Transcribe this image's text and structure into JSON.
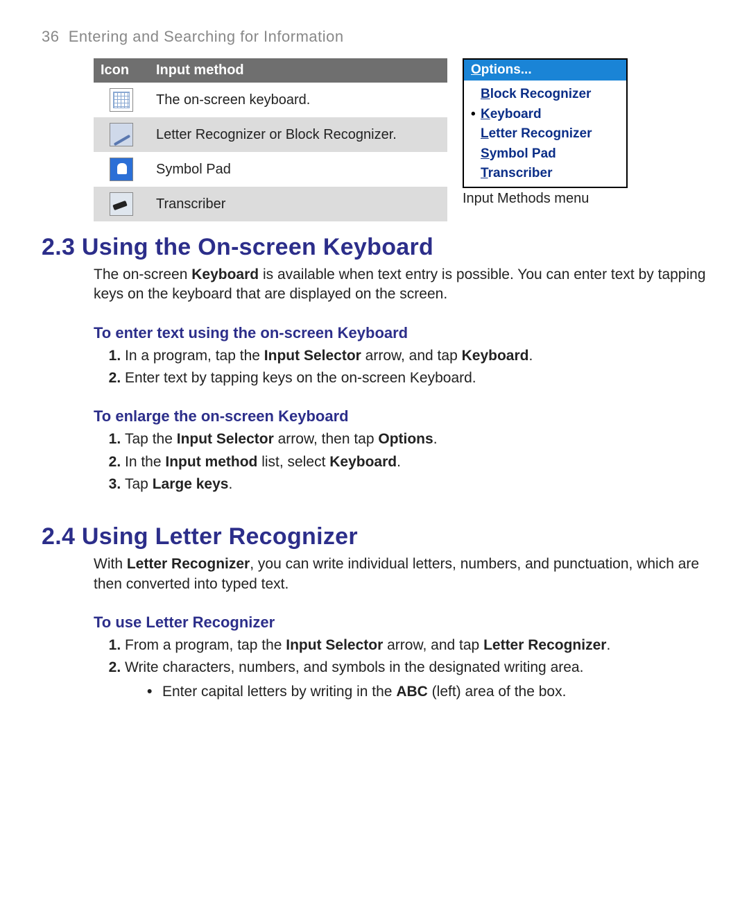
{
  "header": {
    "page_number": "36",
    "chapter_title": "Entering and Searching for Information"
  },
  "icon_table": {
    "headers": {
      "icon": "Icon",
      "method": "Input method"
    },
    "rows": [
      {
        "icon": "keyboard-icon",
        "text": "The on-screen keyboard."
      },
      {
        "icon": "pen-icon",
        "text": "Letter Recognizer or Block Recognizer."
      },
      {
        "icon": "symbol-pad-icon",
        "text": "Symbol Pad"
      },
      {
        "icon": "transcriber-icon",
        "text": "Transcriber"
      }
    ]
  },
  "menu": {
    "title_pre": "O",
    "title_rest": "ptions...",
    "items": [
      {
        "pre": "B",
        "rest": "lock Recognizer",
        "selected": false
      },
      {
        "pre": "K",
        "rest": "eyboard",
        "selected": true
      },
      {
        "pre": "L",
        "rest": "etter Recognizer",
        "selected": false
      },
      {
        "pre": "S",
        "rest": "ymbol Pad",
        "selected": false
      },
      {
        "pre": "T",
        "rest": "ranscriber",
        "selected": false
      }
    ],
    "caption": "Input Methods menu"
  },
  "section_23": {
    "heading": "2.3 Using the On-screen Keyboard",
    "intro_1": "The on-screen ",
    "intro_b1": "Keyboard",
    "intro_2": " is available when text entry is possible. You can enter text by tapping keys on the keyboard that are displayed on the screen.",
    "sub1": "To enter text using the on-screen Keyboard",
    "sub1_step1_a": "In a program, tap the ",
    "sub1_step1_b": "Input Selector",
    "sub1_step1_c": " arrow, and tap ",
    "sub1_step1_d": "Keyboard",
    "sub1_step1_e": ".",
    "sub1_step2": "Enter text by tapping keys on the on-screen Keyboard.",
    "sub2": "To enlarge the on-screen Keyboard",
    "sub2_step1_a": "Tap the ",
    "sub2_step1_b": "Input Selector",
    "sub2_step1_c": " arrow, then tap ",
    "sub2_step1_d": "Options",
    "sub2_step1_e": ".",
    "sub2_step2_a": "In the ",
    "sub2_step2_b": "Input method",
    "sub2_step2_c": " list, select ",
    "sub2_step2_d": "Keyboard",
    "sub2_step2_e": ".",
    "sub2_step3_a": "Tap ",
    "sub2_step3_b": "Large keys",
    "sub2_step3_c": "."
  },
  "section_24": {
    "heading": "2.4 Using Letter Recognizer",
    "intro_1": "With ",
    "intro_b1": "Letter Recognizer",
    "intro_2": ", you can write individual letters, numbers, and punctuation, which are then converted into typed text.",
    "sub1": "To use Letter Recognizer",
    "step1_a": "From a program, tap the ",
    "step1_b": "Input Selector",
    "step1_c": " arrow, and tap ",
    "step1_d": "Letter Recognizer",
    "step1_e": ".",
    "step2": "Write characters, numbers, and symbols in the designated writing area.",
    "bullet1_a": "Enter capital letters by writing in the ",
    "bullet1_b": "ABC",
    "bullet1_c": " (left) area of the box."
  }
}
